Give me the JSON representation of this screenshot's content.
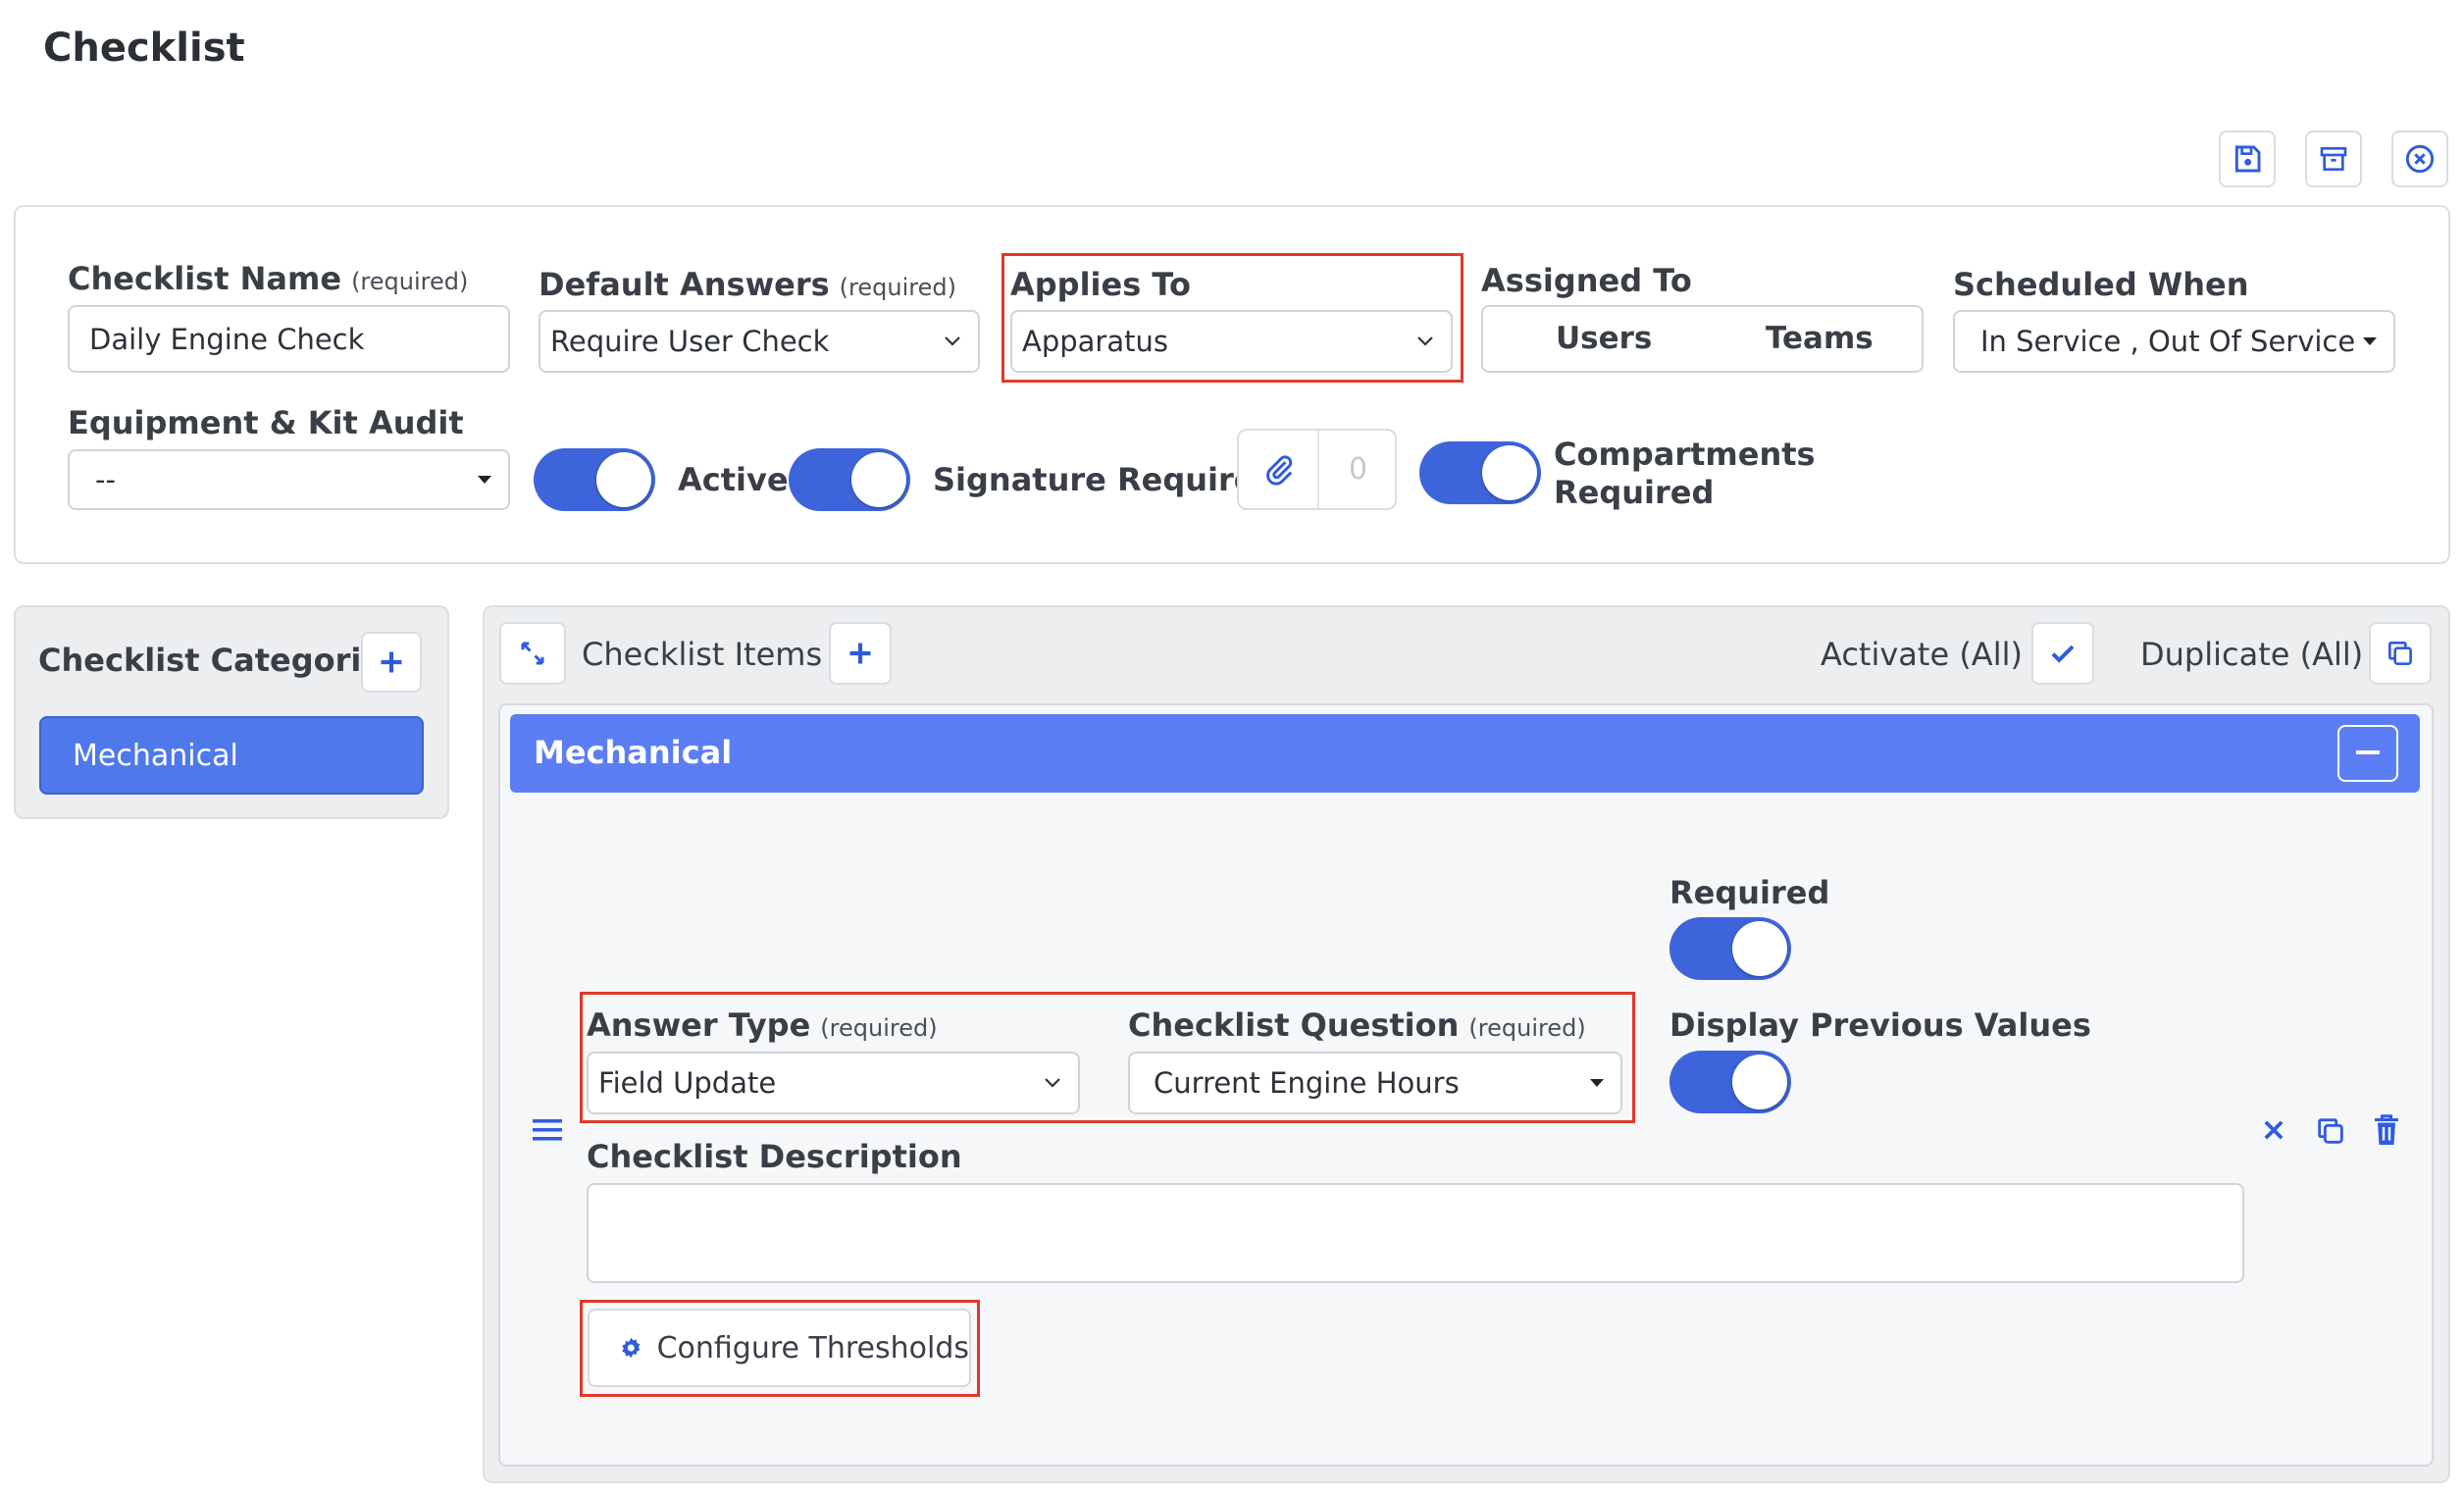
{
  "page": {
    "title": "Checklist"
  },
  "toolbar": {
    "save": "save-icon",
    "archive": "archive-icon",
    "close": "close-circle-icon"
  },
  "form": {
    "checklist_name": {
      "label": "Checklist Name",
      "required": "(required)",
      "value": "Daily Engine Check"
    },
    "default_answers": {
      "label": "Default Answers",
      "required": "(required)",
      "value": "Require User Check"
    },
    "applies_to": {
      "label": "Applies To",
      "value": "Apparatus"
    },
    "assigned_to": {
      "label": "Assigned To",
      "users": "Users",
      "teams": "Teams"
    },
    "scheduled_when": {
      "label": "Scheduled When",
      "value": "In Service , Out Of Service"
    },
    "equipment_audit": {
      "label": "Equipment & Kit Audit",
      "value": "--"
    },
    "active": {
      "label": "Active",
      "on": true
    },
    "signature": {
      "label": "Signature Required",
      "on": true
    },
    "attachments": {
      "count": "0"
    },
    "compartments": {
      "label_line1": "Compartments",
      "label_line2": "Required",
      "on": true
    }
  },
  "categories": {
    "title": "Checklist Categories",
    "items": [
      "Mechanical"
    ]
  },
  "items": {
    "title": "Checklist Items",
    "activate_all": "Activate (All)",
    "duplicate_all": "Duplicate (All)",
    "group": {
      "name": "Mechanical",
      "item": {
        "required_label": "Required",
        "display_prev_label": "Display Previous Values",
        "answer_type": {
          "label": "Answer Type",
          "required": "(required)",
          "value": "Field Update"
        },
        "question": {
          "label": "Checklist Question",
          "required": "(required)",
          "value": "Current Engine Hours"
        },
        "description": {
          "label": "Checklist Description",
          "value": ""
        },
        "configure_thresholds": "Configure Thresholds"
      }
    }
  },
  "colors": {
    "accent": "#3e64dc",
    "header_bar": "#5b7ef5",
    "highlight": "#e0392b"
  }
}
